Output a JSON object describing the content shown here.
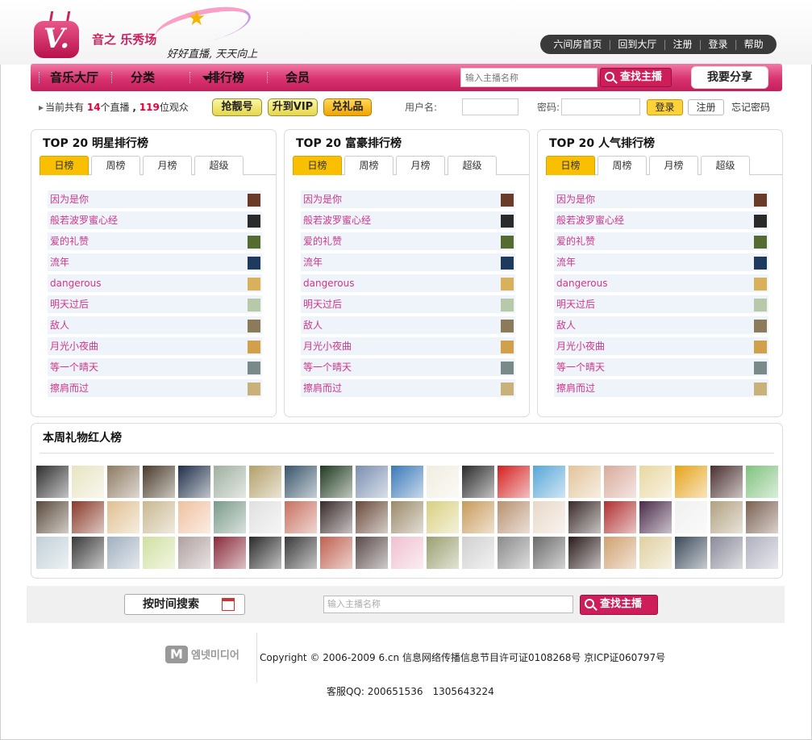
{
  "header": {
    "logo_text": "V.",
    "logo_name": "音之 乐秀场",
    "slogan": "好好直播, 天天向上",
    "top_links": [
      "六间房首页",
      "回到大厅",
      "注册",
      "登录",
      "帮助"
    ]
  },
  "nav": {
    "items": [
      "音乐大厅",
      "分类",
      "排行榜",
      "会员"
    ],
    "search_placeholder": "输入主播名称",
    "search_button": "查找主播",
    "share_button": "我要分享"
  },
  "info": {
    "prefix": "当前共有",
    "live_count": "14",
    "live_suffix": "个直播",
    "viewer_count": "119",
    "viewer_suffix": "位观众",
    "buttons": [
      "抢靓号",
      "升到VIP",
      "兑礼品"
    ],
    "username_label": "用户名:",
    "password_label": "密码:",
    "login_button": "登录",
    "register_button": "注册",
    "forgot_link": "忘记密码"
  },
  "rankings": [
    {
      "title": "TOP 20 明星排行榜",
      "tabs": [
        "日榜",
        "周榜",
        "月榜",
        "超级"
      ],
      "active_tab": 0,
      "items": [
        "因为是你",
        "般若波罗蜜心经",
        "爱的礼赞",
        "流年",
        "dangerous",
        "明天过后",
        "敌人",
        "月光小夜曲",
        "等一个晴天",
        "擦肩而过"
      ]
    },
    {
      "title": "TOP 20 富豪排行榜",
      "tabs": [
        "日榜",
        "周榜",
        "月榜",
        "超级"
      ],
      "active_tab": 0,
      "items": [
        "因为是你",
        "般若波罗蜜心经",
        "爱的礼赞",
        "流年",
        "dangerous",
        "明天过后",
        "敌人",
        "月光小夜曲",
        "等一个晴天",
        "擦肩而过"
      ]
    },
    {
      "title": "TOP 20 人气排行榜",
      "tabs": [
        "日榜",
        "周榜",
        "月榜",
        "超级"
      ],
      "active_tab": 0,
      "items": [
        "因为是你",
        "般若波罗蜜心经",
        "爱的礼赞",
        "流年",
        "dangerous",
        "明天过后",
        "敌人",
        "月光小夜曲",
        "等一个晴天",
        "擦肩而过"
      ]
    }
  ],
  "avatar_colors": [
    "#6b3b2a",
    "#2a2a2a",
    "#556b2f",
    "#1e3a5f",
    "#d8b15a",
    "#b7c9a8",
    "#8c7b5a",
    "#d0a14a",
    "#7a8a88",
    "#c9b27a"
  ],
  "gifts": {
    "title": "本周礼物红人榜",
    "photo_colors": [
      "#2e2e2e",
      "#e8e4c2",
      "#8d7a62",
      "#4a3b2a",
      "#1f2f4a",
      "#9fb0a0",
      "#b3a06a",
      "#38556b",
      "#1f3a1f",
      "#7a8fb0",
      "#3a79b8",
      "#f1ede0",
      "#2a2a2a",
      "#d42020",
      "#57a6d8",
      "#e2c49a",
      "#d9aa9c",
      "#e8d7a0",
      "#e6a31a",
      "#4a2e2e",
      "#7fc27f",
      "#5a4a3a",
      "#8a3a2a",
      "#e0c090",
      "#c9b890",
      "#f0c0a0",
      "#7a9a8a",
      "#e0e0e0",
      "#c87060",
      "#3a2a2a",
      "#6a4a3a",
      "#9a8a6a",
      "#d8d080",
      "#c89a5a",
      "#b89070",
      "#e8d8c8",
      "#3a2a2a",
      "#b03030",
      "#4a2a4a",
      "#f0f0f0",
      "#b0a080",
      "#7a6050",
      "#c0d0d8",
      "#3a3a3a",
      "#a0b0c0",
      "#d0e0a0",
      "#b0a0a0",
      "#8a2a3a",
      "#2a2a2a",
      "#3a3a3a",
      "#c06050",
      "#5a4a4a",
      "#f0c0d0",
      "#9aa070",
      "#d0d0d0",
      "#8a8a8a",
      "#6a6a6a",
      "#2a1a1a",
      "#d0a070",
      "#e0d0a0",
      "#3a4a5a",
      "#8a8a9a",
      "#b0b0c0"
    ]
  },
  "bottom_search": {
    "time_button": "按时间搜索",
    "placeholder": "输入主播名称",
    "search_button": "查找主播"
  },
  "footer": {
    "logo_mark": "M",
    "logo_text": "엠넷미디어",
    "copyright": "Copyright © 2006-2009 6.cn 信息网络传播信息节目许可证0108268号 京ICP证060797号",
    "service": "客服QQ: 200651536　1305643224"
  }
}
